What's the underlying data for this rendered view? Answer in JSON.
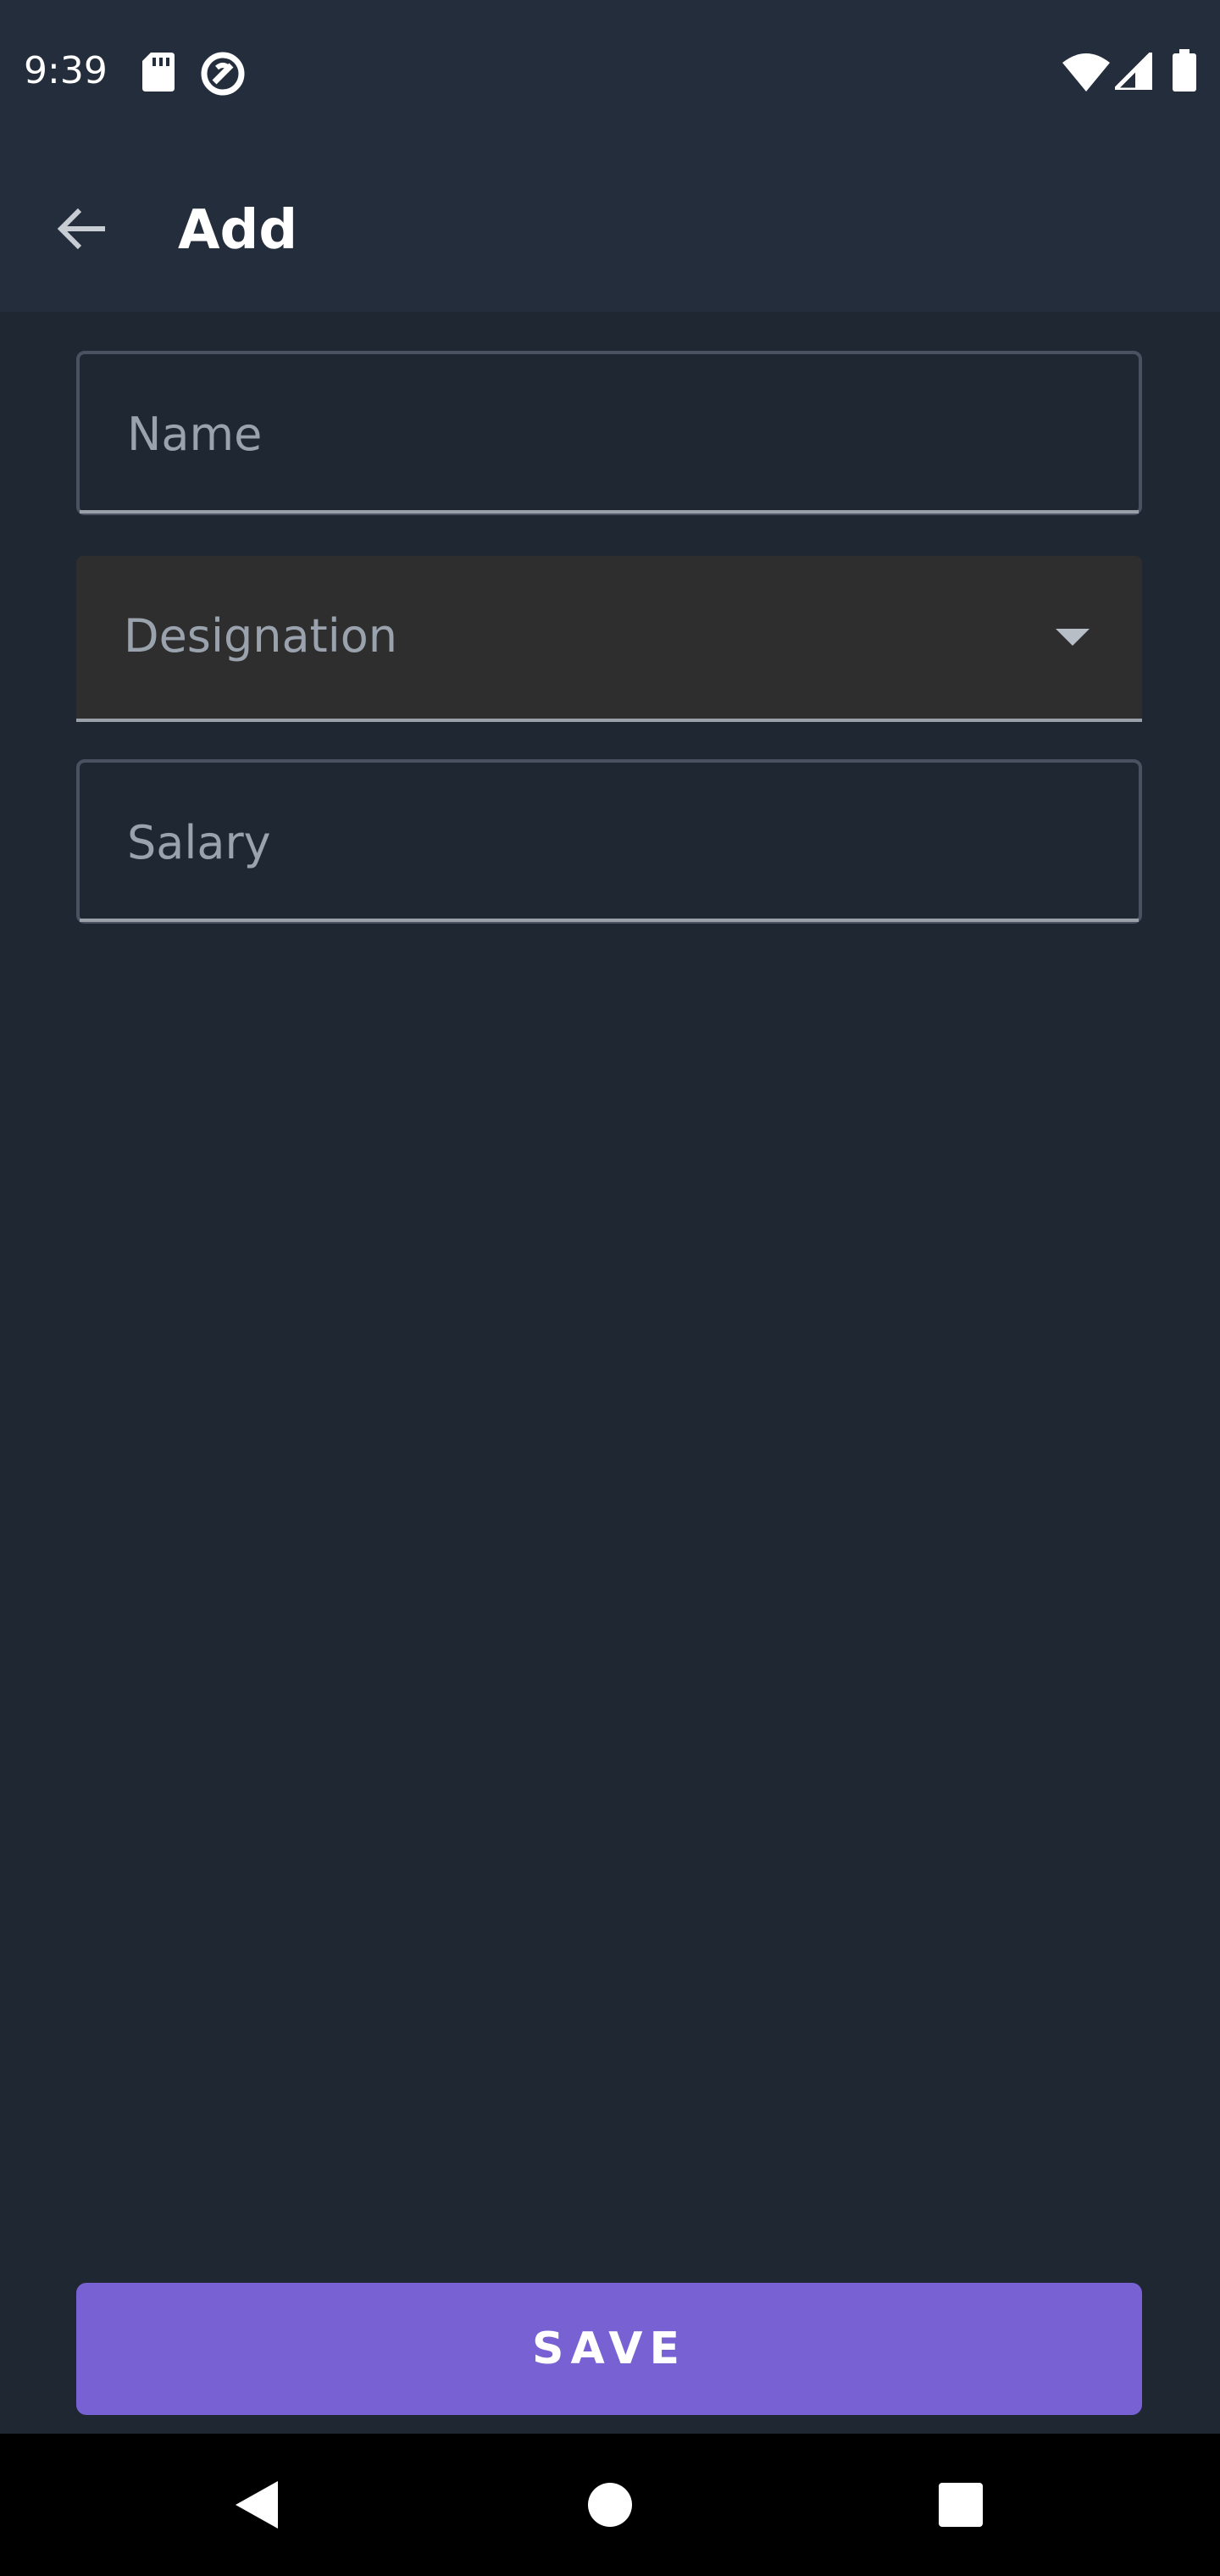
{
  "status_bar": {
    "time": "9:39",
    "icons": [
      "sd-card-icon",
      "data-saver-icon",
      "wifi-icon",
      "cell-signal-icon",
      "battery-icon"
    ]
  },
  "app_bar": {
    "title": "Add",
    "back_icon": "arrow-back-icon"
  },
  "form": {
    "name_label": "Name",
    "designation_label": "Designation",
    "designation_icon": "dropdown-arrow-icon",
    "salary_label": "Salary"
  },
  "actions": {
    "save_label": "SAVE"
  },
  "nav_bar": {
    "icons": [
      "back-triangle-icon",
      "home-circle-icon",
      "recents-square-icon"
    ]
  },
  "colors": {
    "background": "#1f2733",
    "app_bar": "#232d3b",
    "accent": "#7862d3",
    "filled_field": "#2e2e2e"
  }
}
